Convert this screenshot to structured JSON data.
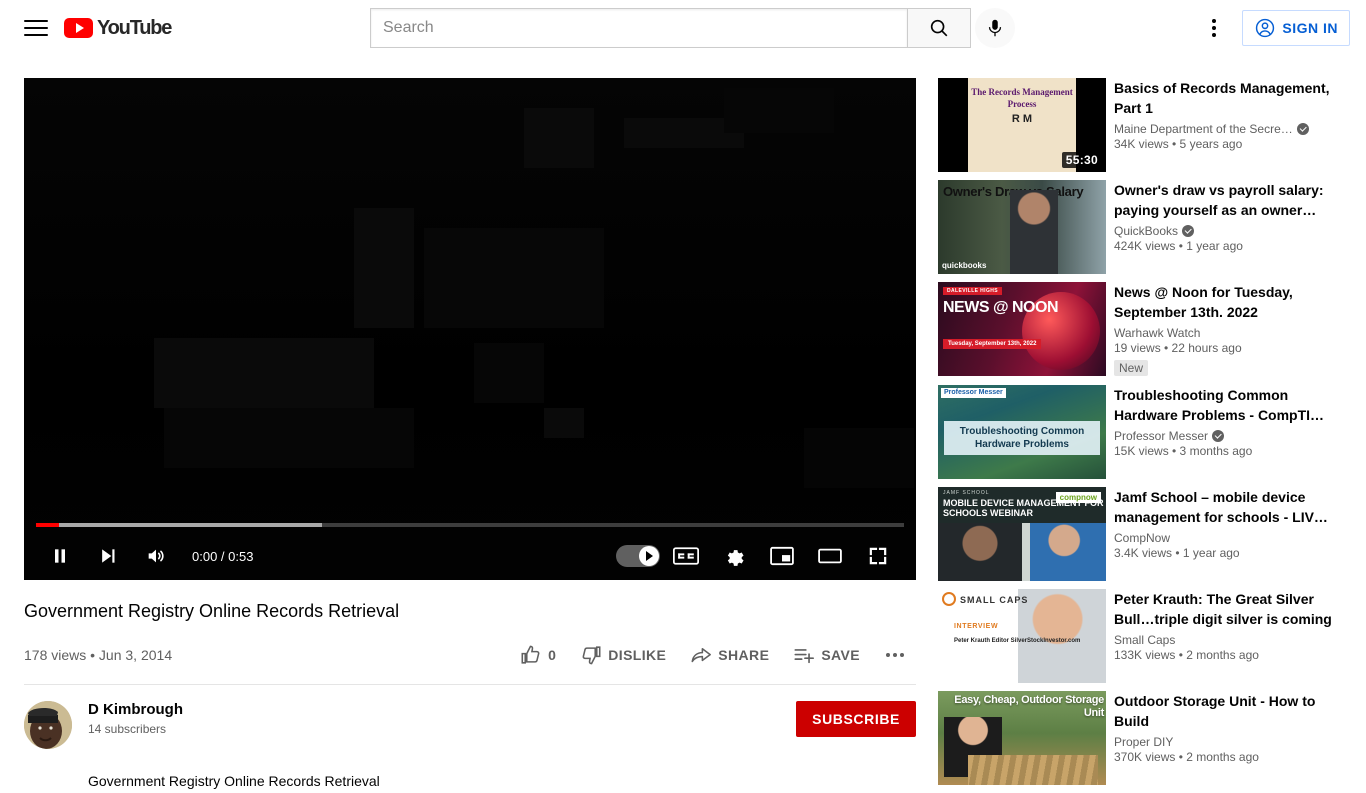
{
  "header": {
    "menu_label": "Guide menu",
    "logo_text": "YouTube",
    "search_placeholder": "Search",
    "search_value": "",
    "search_button_label": "Search",
    "mic_label": "Search with your voice",
    "settings_label": "Settings",
    "sign_in_label": "SIGN IN"
  },
  "player": {
    "current_time": "0:00",
    "duration": "0:53",
    "time_display": "0:00 / 0:53",
    "played_percent": 2.6,
    "buffered_percent": 33,
    "pause_label": "Pause",
    "next_label": "Next",
    "volume_label": "Mute",
    "autoplay_label": "Autoplay is on",
    "captions_label": "CC",
    "settings_label": "Settings",
    "miniplayer_label": "Miniplayer",
    "theater_label": "Theater mode",
    "fullscreen_label": "Full screen",
    "progress_color": "#ff0000",
    "buffer_color": "#a8a8a8"
  },
  "video": {
    "title": "Government Registry Online Records Retrieval",
    "views": "178 views",
    "separator": "•",
    "date": "Jun 3, 2014",
    "meta_line": "178 views • Jun 3, 2014",
    "like_count": "0",
    "like_label": "like",
    "dislike_label": "DISLIKE",
    "share_label": "SHARE",
    "save_label": "SAVE",
    "more_label": "More actions",
    "description": "Government Registry Online Records Retrieval"
  },
  "channel": {
    "name": "D Kimbrough",
    "subscribers": "14 subscribers",
    "subscribe_label": "SUBSCRIBE",
    "subscribe_color": "#cc0000"
  },
  "related": [
    {
      "title": "Basics of Records Management, Part 1",
      "channel": "Maine Department of the Secre…",
      "verified": true,
      "stats": "34K views • 5 years ago",
      "duration": "55:30",
      "badge": "",
      "thumb_type": "records",
      "thumb_text": "The Records Management Process",
      "thumb_mark": "R M"
    },
    {
      "title": "Owner's draw vs payroll salary: paying yourself as an owner…",
      "channel": "QuickBooks",
      "verified": true,
      "stats": "424K views • 1 year ago",
      "duration": "",
      "badge": "",
      "thumb_type": "owner",
      "thumb_text": "Owner's Draw vs Salary",
      "thumb_mark": "quickbooks"
    },
    {
      "title": "News @ Noon for Tuesday, September 13th. 2022",
      "channel": "Warhawk Watch",
      "verified": false,
      "stats": "19 views • 22 hours ago",
      "duration": "",
      "badge": "New",
      "thumb_type": "news",
      "thumb_text": "NEWS @ NOON",
      "thumb_mark": "DALEVILLE HIGHS",
      "thumb_sub": "Tuesday, September 13th, 2022"
    },
    {
      "title": "Troubleshooting Common Hardware Problems - CompTI…",
      "channel": "Professor Messer",
      "verified": true,
      "stats": "15K views • 3 months ago",
      "duration": "",
      "badge": "",
      "thumb_type": "tsc",
      "thumb_text": "Troubleshooting Common Hardware Problems",
      "thumb_mark": "Professor Messer"
    },
    {
      "title": "Jamf School – mobile device management for schools - LIV…",
      "channel": "CompNow",
      "verified": false,
      "stats": "3.4K views • 1 year ago",
      "duration": "",
      "badge": "",
      "thumb_type": "jamf",
      "thumb_text": "MOBILE DEVICE MANAGEMENT FOR SCHOOLS WEBINAR",
      "thumb_mark": "JAMF SCHOOL",
      "thumb_sub": "compnow"
    },
    {
      "title": "Peter Krauth: The Great Silver Bull…triple digit silver is coming",
      "channel": "Small Caps",
      "verified": false,
      "stats": "133K views • 2 months ago",
      "duration": "",
      "badge": "",
      "thumb_type": "silver",
      "thumb_text": "SMALL CAPS",
      "thumb_mark": "INTERVIEW",
      "thumb_sub": "Peter Krauth Editor SilverStockInvestor.com"
    },
    {
      "title": "Outdoor Storage Unit - How to Build",
      "channel": "Proper DIY",
      "verified": false,
      "stats": "370K views • 2 months ago",
      "duration": "",
      "badge": "",
      "thumb_type": "outdoor",
      "thumb_text": "Easy, Cheap, Outdoor Storage Unit",
      "thumb_mark": ""
    }
  ]
}
